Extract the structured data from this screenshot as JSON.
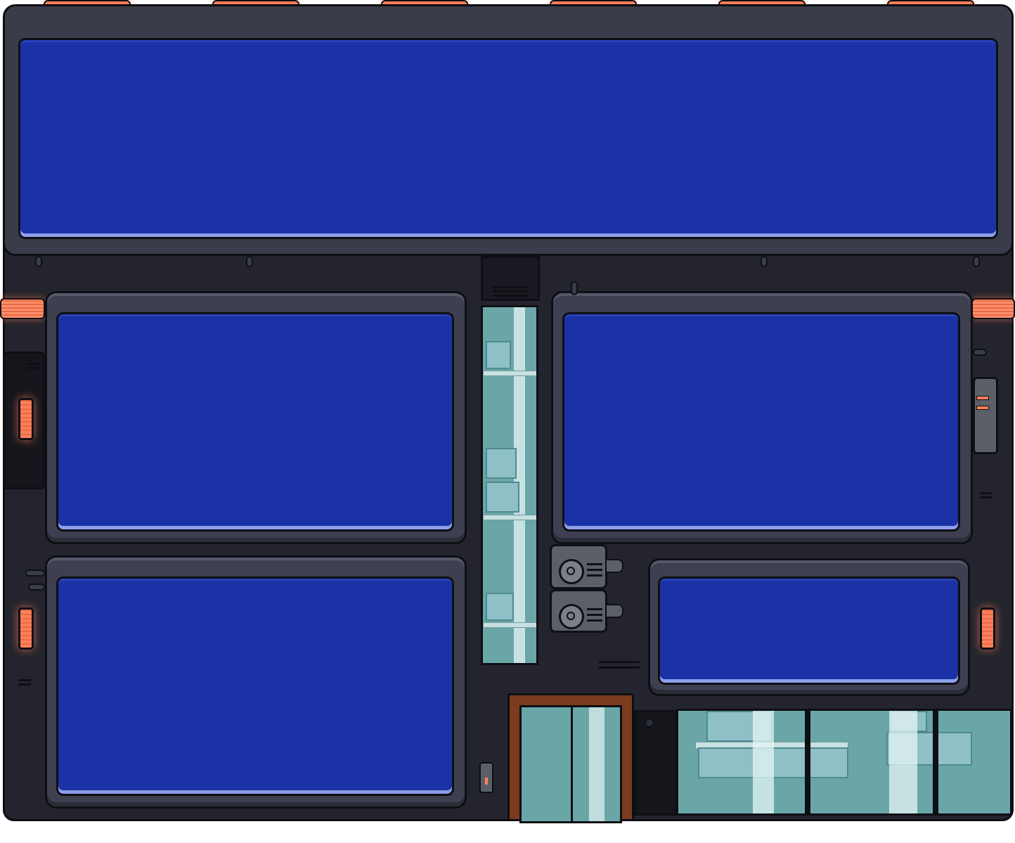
{
  "scene": {
    "type": "pixel-art building facade",
    "colors": {
      "screen": "#1a32a6",
      "frame": "#3e4050",
      "wall": "#23242d",
      "accent_light": "#ff7f5a",
      "glass": "#6aa6a8",
      "door_frame": "#7a3b1e"
    },
    "billboards": [
      "top-banner",
      "left-upper",
      "right-upper",
      "left-lower",
      "right-lower"
    ],
    "icons": [
      "roof-light-icon",
      "wall-lamp-icon",
      "ac-unit-icon",
      "door-icon",
      "window-icon"
    ]
  }
}
